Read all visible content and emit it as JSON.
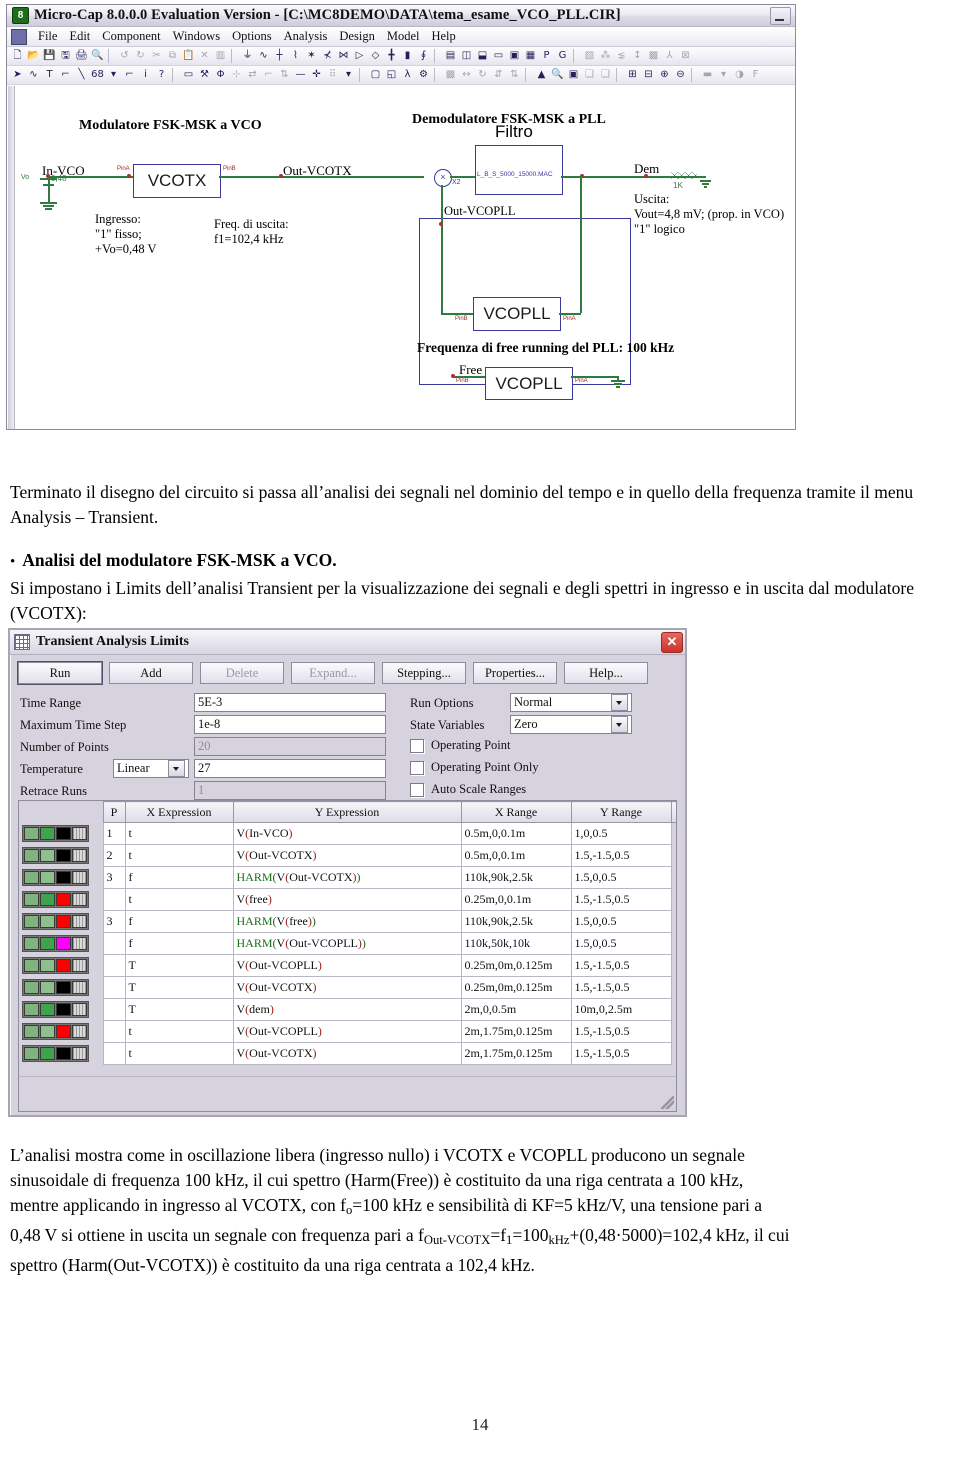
{
  "app": {
    "title": "Micro-Cap 8.0.0.0 Evaluation Version - [C:\\MC8DEMO\\DATA\\tema_esame_VCO_PLL.CIR]",
    "icon": "8",
    "minimize_label": "–",
    "menu": [
      {
        "label": "File"
      },
      {
        "label": "Edit"
      },
      {
        "label": "Component"
      },
      {
        "label": "Windows"
      },
      {
        "label": "Options"
      },
      {
        "label": "Analysis"
      },
      {
        "label": "Design"
      },
      {
        "label": "Model"
      },
      {
        "label": "Help"
      }
    ],
    "toolbar_row1": [
      "new-file-icon",
      "open-folder-icon",
      "save-icon",
      "save-all-icon",
      "print-icon",
      "print-preview-icon",
      "sep",
      "undo-icon",
      "redo-icon",
      "cut-icon",
      "copy-icon",
      "paste-icon",
      "delete-icon",
      "clear-icon",
      "sep",
      "ground-icon",
      "resistor-icon",
      "capacitor-icon",
      "inductor-icon",
      "diode-icon",
      "transistor-icon",
      "npn-icon",
      "pnp-icon",
      "source-icon",
      "battery-icon",
      "opamp-icon",
      "switch-icon",
      "sep",
      "text-area-icon",
      "split-h-icon",
      "split-v-icon",
      "window-icon",
      "grid-icon",
      "table-icon",
      "p-label-icon",
      "g-label-icon",
      "sep",
      "probe1-icon",
      "probe2-icon",
      "probe3-icon",
      "info-icon",
      "plot-icon",
      "axis-icon",
      "graph-icon"
    ],
    "toolbar_row2": [
      "select-arrow-icon",
      "wire-icon",
      "text-tool-icon",
      "polyline-icon",
      "line-icon",
      "ellipse-icon",
      "dropdown-icon",
      "flag-icon",
      "info-pin-icon",
      "help-pointer-icon",
      "sep",
      "text-box-icon",
      "node-name-icon",
      "node-voltage-icon",
      "pin-connect-icon",
      "flip-icon",
      "rotate-pin-icon",
      "mirror-icon",
      "wire-straight-icon",
      "plus-icon",
      "grid-dots-icon",
      "grid-dropdown-icon",
      "sep",
      "rect-icon",
      "rounded-rect-icon",
      "lambda-icon",
      "properties-icon",
      "sep",
      "attribute-icon",
      "move-icon",
      "rotate-icon",
      "flip-x-icon",
      "flip-y-icon",
      "sep",
      "step-icon",
      "find-icon",
      "monitor-icon",
      "copy-page-icon",
      "paste-page-icon",
      "sep",
      "add-page-icon",
      "remove-page-icon",
      "zoom-in-icon",
      "zoom-out-icon",
      "sep",
      "line-style-icon",
      "line-dropdown-icon",
      "color-icon",
      "f-icon"
    ]
  },
  "schematic": {
    "title_left": "Modulatore FSK-MSK a VCO",
    "title_right": "Demodulatore FSK-MSK a PLL",
    "nodes": {
      "in_vco": "In-VCO",
      "out_vcotx": "Out-VCOTX",
      "out_vcopll": "Out-VCOPLL",
      "dem": "Dem",
      "free": "Free"
    },
    "source": {
      "name": "Vo",
      "value": "0,48"
    },
    "blocks": {
      "vcotx": "VCOTX",
      "vcopll": "VCOPLL",
      "vcopll2": "VCOPLL",
      "filter_title": "Filtro",
      "filter_macro": "L_B_S_5000_15000.MAC",
      "mixer_ref": "X2",
      "resistor": "1K"
    },
    "pins": {
      "a": "PinA",
      "b": "PinB"
    },
    "notes": {
      "ingresso": "Ingresso:\n\"1\" fisso;\n+Vo=0,48 V",
      "freq_uscita": "Freq. di uscita:\nf1=102,4 kHz",
      "uscita": "Uscita:\nVout=4,8 mV; (prop. in VCO)\n\"1\" logico",
      "free_running": "Frequenza di free running del PLL: 100 kHz"
    }
  },
  "doc": {
    "para1": "Terminato il disegno del circuito si passa all’analisi dei segnali nel dominio del tempo e in quello della frequenza tramite il menu Analysis – Transient.",
    "bullet_marker": "•",
    "bullet_title": "Analisi del modulatore FSK-MSK a VCO.",
    "para2": "Si impostano i Limits dell’analisi Transient per la visualizzazione dei segnali e degli spettri in ingresso e in uscita dal modulatore (VCOTX):",
    "para3_line1": "L’analisi mostra come in oscillazione libera (ingresso nullo) i VCOTX e VCOPLL producono un segnale",
    "para3_line2": "sinusoidale di frequenza 100 kHz, il cui spettro (Harm(Free)) è costituito da una riga centrata a 100 kHz,",
    "para3_line3": "mentre applicando in ingresso al VCOTX, con f",
    "para3_line3b": "=100 kHz e sensibilità di KF=5 kHz/V, una tensione pari a",
    "para3_line4a": "0,48 V si ottiene in uscita un segnale con frequenza pari a f",
    "para3_line4b": "Out-VCOTX",
    "para3_line4c": "=f",
    "para3_line4d": "1",
    "para3_line4e": "=100",
    "para3_line4f": "kHz",
    "para3_line4g": "+(0,48·5000)=102,4 kHz, il cui",
    "para3_line5": "spettro (Harm(Out-VCOTX)) è costituito da una riga centrata a 102,4 kHz.",
    "sub_o": "o",
    "page_number": "14"
  },
  "dialog": {
    "title": "Transient Analysis Limits",
    "close_label": "✕",
    "buttons": [
      {
        "label": "Run",
        "enabled": true,
        "primary": true
      },
      {
        "label": "Add",
        "enabled": true,
        "primary": false
      },
      {
        "label": "Delete",
        "enabled": false,
        "primary": false
      },
      {
        "label": "Expand...",
        "enabled": false,
        "primary": false
      },
      {
        "label": "Stepping...",
        "enabled": true,
        "primary": false
      },
      {
        "label": "Properties...",
        "enabled": true,
        "primary": false
      },
      {
        "label": "Help...",
        "enabled": true,
        "primary": false
      }
    ],
    "fields": {
      "time_range_label": "Time Range",
      "time_range_value": "5E-3",
      "max_time_step_label": "Maximum Time Step",
      "max_time_step_value": "1e-8",
      "number_of_points_label": "Number of Points",
      "number_of_points_value": "20",
      "temperature_label": "Temperature",
      "temperature_mode": "Linear",
      "temperature_value": "27",
      "retrace_runs_label": "Retrace Runs",
      "retrace_runs_value": "1",
      "run_options_label": "Run Options",
      "run_options_value": "Normal",
      "state_variables_label": "State Variables",
      "state_variables_value": "Zero",
      "operating_point_label": "Operating Point",
      "operating_point_only_label": "Operating Point Only",
      "auto_scale_ranges_label": "Auto Scale Ranges"
    },
    "table": {
      "headers": [
        "P",
        "X Expression",
        "Y Expression",
        "X Range",
        "Y Range",
        ">"
      ],
      "rows": [
        {
          "colors": [
            "#7fb47f",
            "#3fa34d",
            "#000000",
            "hatch"
          ],
          "p": "1",
          "x": "t",
          "y_raw": "V(In-VCO)",
          "y_fn": "",
          "y_inner": "In-VCO",
          "xr": "0.5m,0,0.1m",
          "yr": "1,0,0.5"
        },
        {
          "colors": [
            "#7fb47f",
            "#8fbf8f",
            "#000000",
            "hatch"
          ],
          "p": "2",
          "x": "t",
          "y_raw": "V(Out-VCOTX)",
          "y_fn": "",
          "y_inner": "Out-VCOTX",
          "xr": "0.5m,0,0.1m",
          "yr": "1.5,-1.5,0.5"
        },
        {
          "colors": [
            "#7fb47f",
            "#8fbf8f",
            "#000000",
            "hatch"
          ],
          "p": "3",
          "x": "f",
          "y_raw": "HARM(V(Out-VCOTX))",
          "y_fn": "HARM",
          "y_inner": "Out-VCOTX",
          "xr": "110k,90k,2.5k",
          "yr": "1.5,0,0.5"
        },
        {
          "colors": [
            "#7fb47f",
            "#3fa34d",
            "#ff0000",
            "hatch"
          ],
          "p": "",
          "x": "t",
          "y_raw": "V(free)",
          "y_fn": "",
          "y_inner": "free",
          "xr": "0.25m,0,0.1m",
          "yr": "1.5,-1.5,0.5"
        },
        {
          "colors": [
            "#7fb47f",
            "#8fbf8f",
            "#ff0000",
            "hatch"
          ],
          "p": "3",
          "x": "f",
          "y_raw": "HARM(V(free))",
          "y_fn": "HARM",
          "y_inner": "free",
          "xr": "110k,90k,2.5k",
          "yr": "1.5,0,0.5"
        },
        {
          "colors": [
            "#7fb47f",
            "#3fa34d",
            "#ff00ff",
            "hatch"
          ],
          "p": "",
          "x": "f",
          "y_raw": "HARM(V(Out-VCOPLL))",
          "y_fn": "HARM",
          "y_inner": "Out-VCOPLL",
          "xr": "110k,50k,10k",
          "yr": "1.5,0,0.5"
        },
        {
          "colors": [
            "#7fb47f",
            "#8fbf8f",
            "#ff0000",
            "hatch"
          ],
          "p": "",
          "x": "T",
          "y_raw": "V(Out-VCOPLL)",
          "y_fn": "",
          "y_inner": "Out-VCOPLL",
          "xr": "0.25m,0m,0.125m",
          "yr": "1.5,-1.5,0.5"
        },
        {
          "colors": [
            "#7fb47f",
            "#8fbf8f",
            "#000000",
            "hatch"
          ],
          "p": "",
          "x": "T",
          "y_raw": "V(Out-VCOTX)",
          "y_fn": "",
          "y_inner": "Out-VCOTX",
          "xr": "0.25m,0m,0.125m",
          "yr": "1.5,-1.5,0.5"
        },
        {
          "colors": [
            "#7fb47f",
            "#3fa34d",
            "#000000",
            "hatch"
          ],
          "p": "",
          "x": "T",
          "y_raw": "V(dem)",
          "y_fn": "",
          "y_inner": "dem",
          "xr": "2m,0,0.5m",
          "yr": "10m,0,2.5m"
        },
        {
          "colors": [
            "#7fb47f",
            "#8fbf8f",
            "#ff0000",
            "hatch"
          ],
          "p": "",
          "x": "t",
          "y_raw": "V(Out-VCOPLL)",
          "y_fn": "",
          "y_inner": "Out-VCOPLL",
          "xr": "2m,1.75m,0.125m",
          "yr": "1.5,-1.5,0.5"
        },
        {
          "colors": [
            "#7fb47f",
            "#3fa34d",
            "#000000",
            "hatch"
          ],
          "p": "",
          "x": "t",
          "y_raw": "V(Out-VCOTX)",
          "y_fn": "",
          "y_inner": "Out-VCOTX",
          "xr": "2m,1.75m,0.125m",
          "yr": "1.5,-1.5,0.5"
        }
      ]
    }
  },
  "colors": {
    "wire_green": "#2f7a3f",
    "block_blue": "#3a3a9c",
    "pin_red": "#9b2b2b",
    "close_red": "#c8352c"
  }
}
